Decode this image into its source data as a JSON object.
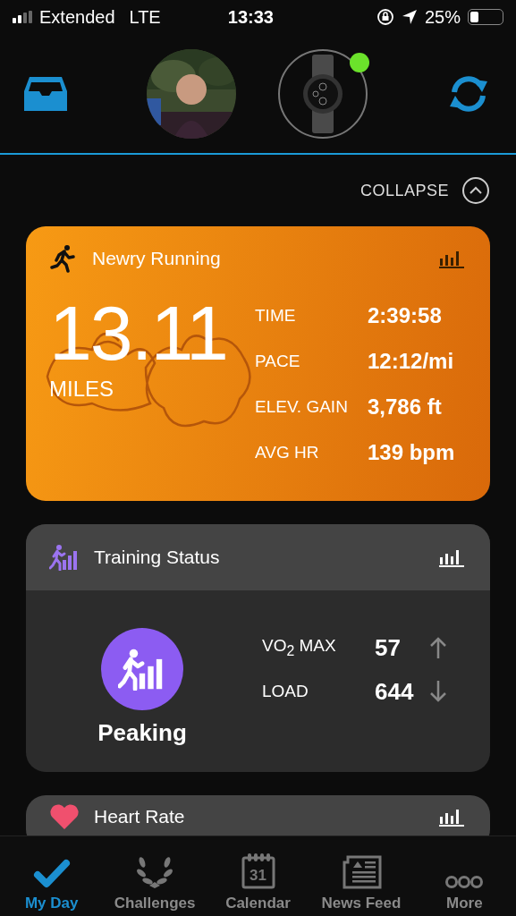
{
  "status_bar": {
    "carrier": "Extended",
    "network": "LTE",
    "time": "13:33",
    "battery": "25%"
  },
  "header": {
    "device_connected": true
  },
  "collapse": {
    "label": "COLLAPSE"
  },
  "activity": {
    "title": "Newry Running",
    "distance": "13.11",
    "unit": "MILES",
    "stats": [
      {
        "label": "TIME",
        "value": "2:39:58"
      },
      {
        "label": "PACE",
        "value": "12:12/mi"
      },
      {
        "label": "ELEV. GAIN",
        "value": "3,786 ft"
      },
      {
        "label": "AVG HR",
        "value": "139 bpm"
      }
    ]
  },
  "training": {
    "title": "Training Status",
    "status": "Peaking",
    "metrics": [
      {
        "label": "VO$_{2}$ MAX",
        "value": "57",
        "kind": "up"
      },
      {
        "label": "LOAD",
        "value": "644",
        "kind": "down"
      }
    ]
  },
  "heart": {
    "title": "Heart Rate"
  },
  "tabs": [
    {
      "label": "My Day",
      "kind": "check",
      "selected": true
    },
    {
      "label": "Challenges",
      "kind": "laurel",
      "selected": false
    },
    {
      "label": "Calendar",
      "kind": "calendar",
      "icon_text": "31",
      "selected": false
    },
    {
      "label": "News Feed",
      "kind": "news",
      "selected": false
    },
    {
      "label": "More",
      "kind": "dots",
      "selected": false
    }
  ]
}
